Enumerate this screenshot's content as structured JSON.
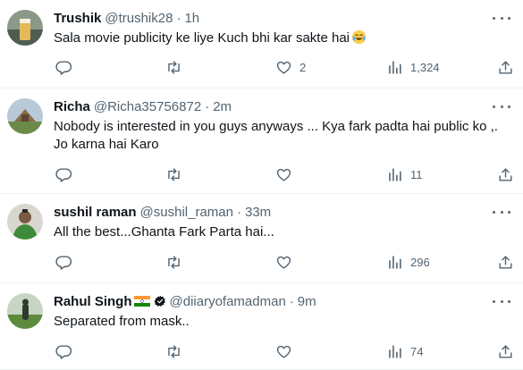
{
  "colors": {
    "text": "#0f1419",
    "secondary": "#536471",
    "divider": "#eff3f4"
  },
  "tweets": [
    {
      "name": "Trushik",
      "handle": "@trushik28",
      "separator": "·",
      "time": "1h",
      "text": "Sala movie publicity ke liye Kuch bhi kar sakte hai",
      "emoji": "face-with-tears-of-joy",
      "replies": "",
      "retweets": "",
      "likes": "2",
      "views": "1,324"
    },
    {
      "name": "Richa",
      "handle": "@Richa35756872",
      "separator": "·",
      "time": "2m",
      "text": "Nobody is interested in you guys anyways ... Kya fark padta hai public ko ,.\nJo karna hai Karo",
      "replies": "",
      "retweets": "",
      "likes": "",
      "views": "11"
    },
    {
      "name": "sushil raman",
      "handle": "@sushil_raman",
      "separator": "·",
      "time": "33m",
      "text": "All the best...Ghanta Fark Parta hai...",
      "replies": "",
      "retweets": "",
      "likes": "",
      "views": "296"
    },
    {
      "name": "Rahul Singh",
      "handle": "@diiaryofamadman",
      "separator": "·",
      "time": "9m",
      "text": "Separated from mask..",
      "replies": "",
      "retweets": "",
      "likes": "",
      "views": "74"
    }
  ]
}
